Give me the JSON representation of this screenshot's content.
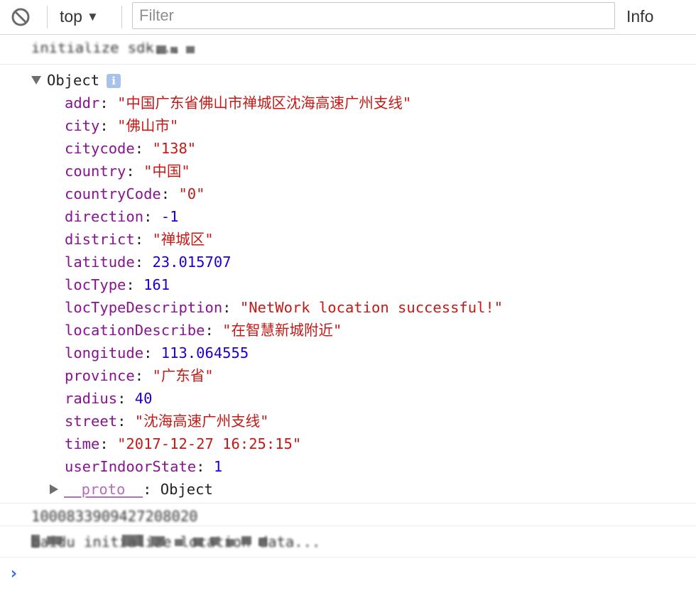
{
  "toolbar": {
    "clear_icon": "block-icon",
    "context": "top",
    "context_caret": "▼",
    "filter_placeholder": "Filter",
    "filter_value": "",
    "log_level": "Info"
  },
  "console": {
    "messages_top": [
      {
        "text": "initialize sdk...",
        "obscured": true
      }
    ],
    "object": {
      "label": "Object",
      "info_badge": "i",
      "properties": [
        {
          "key": "addr",
          "value": "\"中国广东省佛山市禅城区沈海高速广州支线\"",
          "type": "string"
        },
        {
          "key": "city",
          "value": "\"佛山市\"",
          "type": "string"
        },
        {
          "key": "citycode",
          "value": "\"138\"",
          "type": "string"
        },
        {
          "key": "country",
          "value": "\"中国\"",
          "type": "string"
        },
        {
          "key": "countryCode",
          "value": "\"0\"",
          "type": "string"
        },
        {
          "key": "direction",
          "value": "-1",
          "type": "number"
        },
        {
          "key": "district",
          "value": "\"禅城区\"",
          "type": "string"
        },
        {
          "key": "latitude",
          "value": "23.015707",
          "type": "number"
        },
        {
          "key": "locType",
          "value": "161",
          "type": "number"
        },
        {
          "key": "locTypeDescription",
          "value": "\"NetWork location successful!\"",
          "type": "string"
        },
        {
          "key": "locationDescribe",
          "value": "\"在智慧新城附近\"",
          "type": "string"
        },
        {
          "key": "longitude",
          "value": "113.064555",
          "type": "number"
        },
        {
          "key": "province",
          "value": "\"广东省\"",
          "type": "string"
        },
        {
          "key": "radius",
          "value": "40",
          "type": "number"
        },
        {
          "key": "street",
          "value": "\"沈海高速广州支线\"",
          "type": "string"
        },
        {
          "key": "time",
          "value": "\"2017-12-27 16:25:15\"",
          "type": "string"
        },
        {
          "key": "userIndoorState",
          "value": "1",
          "type": "number"
        }
      ],
      "proto": {
        "key": "__proto__",
        "value": "Object"
      }
    },
    "messages_bottom": [
      {
        "text": "1000833909427208020",
        "obscured": true
      },
      {
        "text": "baidu initialize location data...",
        "obscured": true
      }
    ],
    "prompt_symbol": "›",
    "colors": {
      "key": "#881391",
      "string": "#c41a16",
      "number": "#1c00cf",
      "prompt": "#2b72d9",
      "info_badge": "#a9c2ea"
    }
  }
}
